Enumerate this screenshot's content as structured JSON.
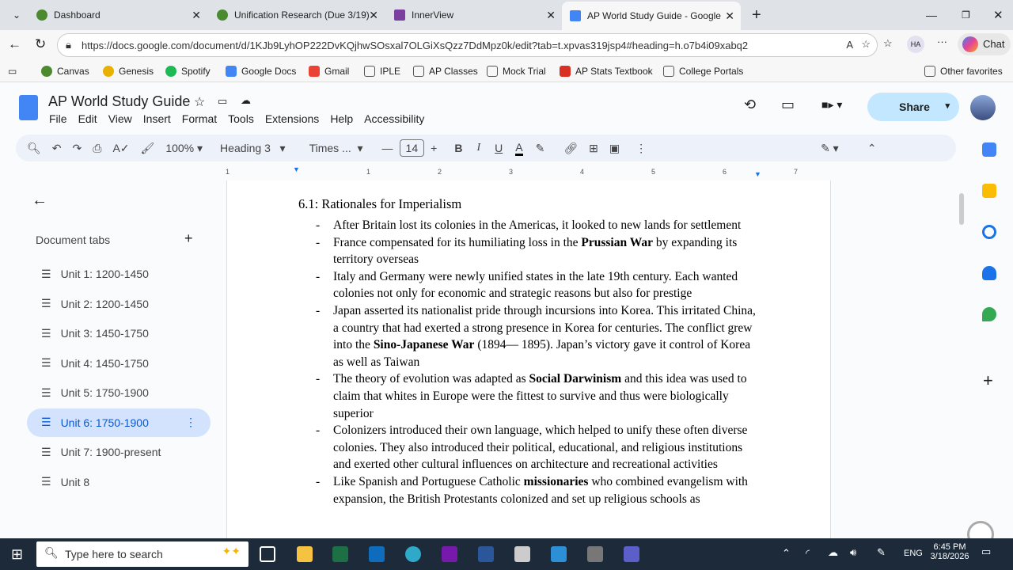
{
  "browser": {
    "tabs": [
      {
        "title": "Dashboard",
        "color": "#4c8a2f"
      },
      {
        "title": "Unification Research (Due 3/19)",
        "color": "#4c8a2f"
      },
      {
        "title": "InnerView",
        "color": "#7b3fa0"
      },
      {
        "title": "AP World Study Guide - Google Do",
        "color": "#4285f4"
      }
    ],
    "url": "https://docs.google.com/document/d/1KJb9LyhOP222DvKQjhwSOsxal7OLGiXsQzz7DdMpz0k/edit?tab=t.xpvas319jsp4#heading=h.o7b4i09xabq2",
    "profile": "HA",
    "chat_label": "Chat",
    "bookmarks": [
      "Canvas",
      "Genesis",
      "Spotify",
      "Google Docs",
      "Gmail",
      "IPLE",
      "AP Classes",
      "Mock Trial",
      "AP Stats Textbook",
      "College Portals"
    ],
    "other_favorites": "Other favorites"
  },
  "doc": {
    "title": "AP World Study Guide",
    "menu": [
      "File",
      "Edit",
      "View",
      "Insert",
      "Format",
      "Tools",
      "Extensions",
      "Help",
      "Accessibility"
    ],
    "share_label": "Share",
    "toolbar": {
      "zoom": "100%",
      "style": "Heading 3",
      "font": "Times ...",
      "size": "14"
    },
    "ruler": [
      "1",
      "1",
      "2",
      "3",
      "4",
      "5",
      "6",
      "7"
    ]
  },
  "sidebar": {
    "title": "Document tabs",
    "items": [
      "Unit 1: 1200-1450",
      "Unit 2: 1200-1450",
      "Unit 3: 1450-1750",
      "Unit 4: 1450-1750",
      "Unit 5: 1750-1900",
      "Unit 6: 1750-1900",
      "Unit 7: 1900-present",
      "Unit 8"
    ],
    "active": 5
  },
  "content": {
    "heading": "6.1: Rationales for Imperialism",
    "bullets": [
      [
        {
          "t": "After Britain lost its colonies in the Americas, it looked to new lands for settlement"
        }
      ],
      [
        {
          "t": "France compensated for its humiliating loss in the "
        },
        {
          "t": "Prussian War",
          "b": true
        },
        {
          "t": " by expanding its territory overseas"
        }
      ],
      [
        {
          "t": "Italy and Germany were newly unified states in the late 19th century. Each wanted colonies not only for economic and strategic reasons but also for prestige"
        }
      ],
      [
        {
          "t": "Japan asserted its nationalist pride through incursions into Korea. This irritated China, a country that had exerted a strong presence in Korea for centuries. The conflict grew into the "
        },
        {
          "t": "Sino-Japanese War",
          "b": true
        },
        {
          "t": " (1894— 1895). Japan’s victory gave it control of Korea as well as Taiwan"
        }
      ],
      [
        {
          "t": "The theory of evolution was adapted as "
        },
        {
          "t": "Social Darwinism",
          "b": true
        },
        {
          "t": " and this idea was used to claim that whites in Europe were the fittest to survive and thus were biologically superior"
        }
      ],
      [
        {
          "t": "Colonizers introduced their own language, which helped to unify these often diverse colonies. They also introduced their political, educational, and religious institutions and exerted other cultural influences on architecture and recreational activities"
        }
      ],
      [
        {
          "t": "Like Spanish and Portuguese Catholic "
        },
        {
          "t": "missionaries",
          "b": true
        },
        {
          "t": " who combined evangelism with expansion, the British Protestants colonized and set up religious schools as"
        }
      ]
    ]
  },
  "taskbar": {
    "search_placeholder": "Type here to search",
    "time": "6:45 PM",
    "date": "3/18/2026",
    "lang": "ENG"
  }
}
